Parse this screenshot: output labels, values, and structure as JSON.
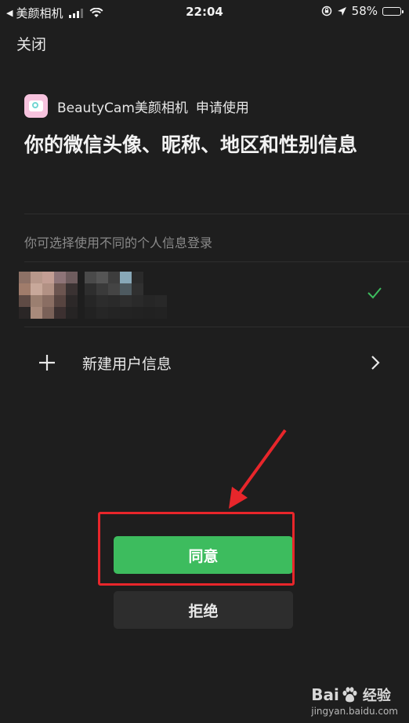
{
  "status_bar": {
    "back_app": "美颜相机",
    "time": "22:04",
    "battery": "58%",
    "battery_level": 0.58,
    "battery_color": "#f5d23b"
  },
  "nav": {
    "close": "关闭"
  },
  "app": {
    "name": "BeautyCam美颜相机",
    "request": "申请使用",
    "logo_color": "#f7c3de"
  },
  "permission": {
    "headline": "你的微信头像、昵称、地区和性别信息"
  },
  "profile": {
    "hint": "你可选择使用不同的个人信息登录",
    "selected": true,
    "new_user_label": "新建用户信息"
  },
  "buttons": {
    "agree": "同意",
    "reject": "拒绝",
    "agree_color": "#3dbc5e"
  },
  "annotation": {
    "color": "#e8262b"
  },
  "watermark": {
    "brand": "Bai",
    "brand_suffix": "经验",
    "url": "jingyan.baidu.com"
  }
}
